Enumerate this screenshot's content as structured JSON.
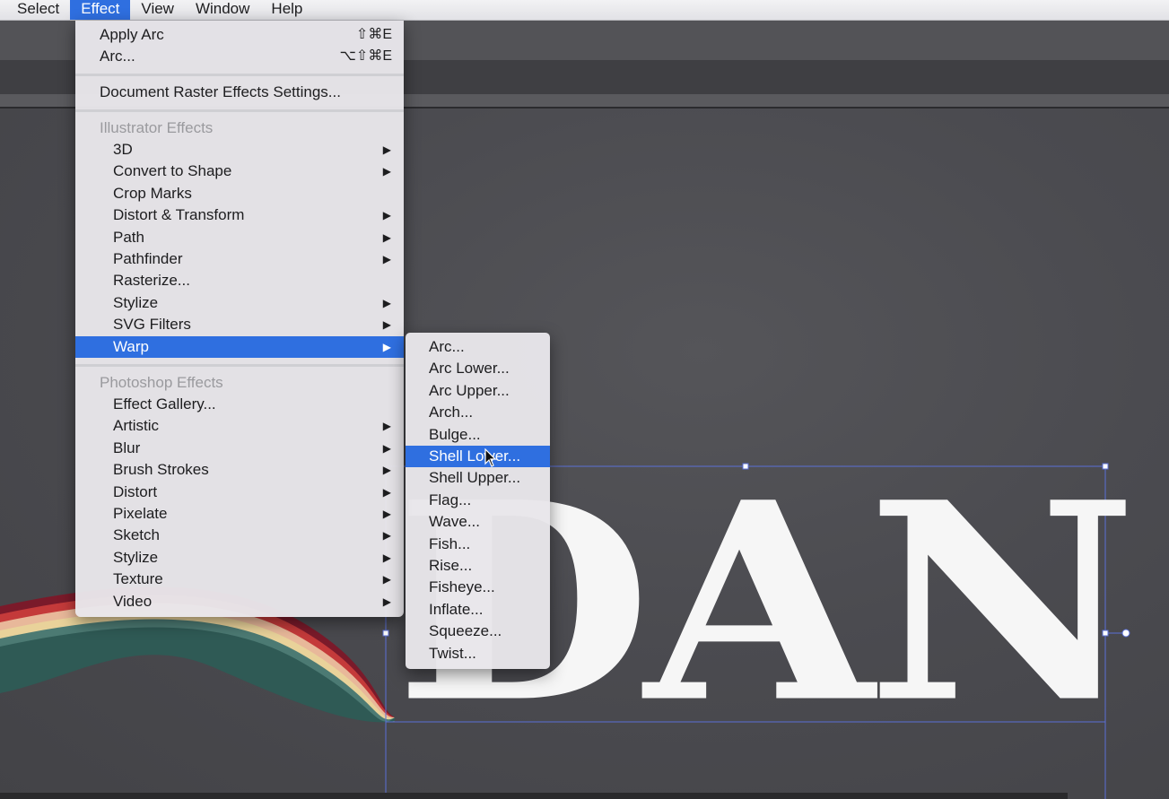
{
  "menubar": {
    "items": [
      {
        "label": "Select"
      },
      {
        "label": "Effect"
      },
      {
        "label": "View"
      },
      {
        "label": "Window"
      },
      {
        "label": "Help"
      }
    ],
    "active_index": 1
  },
  "effect_menu": {
    "apply_arc": {
      "label": "Apply Arc",
      "shortcut": "⇧⌘E"
    },
    "arc": {
      "label": "Arc...",
      "shortcut": "⌥⇧⌘E"
    },
    "document_raster": {
      "label": "Document Raster Effects Settings..."
    },
    "illustrator_header": "Illustrator Effects",
    "illustrator_items": [
      {
        "label": "3D",
        "submenu": true
      },
      {
        "label": "Convert to Shape",
        "submenu": true
      },
      {
        "label": "Crop Marks",
        "submenu": false
      },
      {
        "label": "Distort & Transform",
        "submenu": true
      },
      {
        "label": "Path",
        "submenu": true
      },
      {
        "label": "Pathfinder",
        "submenu": true
      },
      {
        "label": "Rasterize...",
        "submenu": false
      },
      {
        "label": "Stylize",
        "submenu": true
      },
      {
        "label": "SVG Filters",
        "submenu": true
      },
      {
        "label": "Warp",
        "submenu": true,
        "highlighted": true
      }
    ],
    "photoshop_header": "Photoshop Effects",
    "photoshop_items": [
      {
        "label": "Effect Gallery...",
        "submenu": false
      },
      {
        "label": "Artistic",
        "submenu": true
      },
      {
        "label": "Blur",
        "submenu": true
      },
      {
        "label": "Brush Strokes",
        "submenu": true
      },
      {
        "label": "Distort",
        "submenu": true
      },
      {
        "label": "Pixelate",
        "submenu": true
      },
      {
        "label": "Sketch",
        "submenu": true
      },
      {
        "label": "Stylize",
        "submenu": true
      },
      {
        "label": "Texture",
        "submenu": true
      },
      {
        "label": "Video",
        "submenu": true
      }
    ],
    "submenu_arrow": "▶"
  },
  "warp_submenu": {
    "items": [
      {
        "label": "Arc..."
      },
      {
        "label": "Arc Lower..."
      },
      {
        "label": "Arc Upper..."
      },
      {
        "label": "Arch..."
      },
      {
        "label": "Bulge..."
      },
      {
        "label": "Shell Lower...",
        "highlighted": true
      },
      {
        "label": "Shell Upper..."
      },
      {
        "label": "Flag..."
      },
      {
        "label": "Wave..."
      },
      {
        "label": "Fish..."
      },
      {
        "label": "Rise..."
      },
      {
        "label": "Fisheye..."
      },
      {
        "label": "Inflate..."
      },
      {
        "label": "Squeeze..."
      },
      {
        "label": "Twist..."
      }
    ]
  },
  "artwork": {
    "text": "DAN",
    "text_color": "#f6f6f6",
    "selection_color": "#5a6fd6",
    "stripe_colors": [
      "#7a1a2a",
      "#c43a3a",
      "#e8b89a",
      "#e9d29a",
      "#4c7a73",
      "#2f5a55"
    ]
  },
  "colors": {
    "menu_highlight": "#2f6fe0",
    "canvas": "#4a4a4f"
  }
}
